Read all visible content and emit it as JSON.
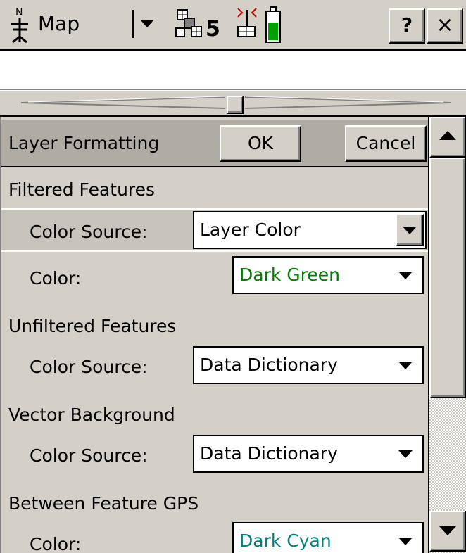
{
  "topbar": {
    "section_label": "Map",
    "north_icon": "north-arrow-icon",
    "satellite_icon": "satellite-icon",
    "satellite_count": "5",
    "beacon_icon": "beacon-icon",
    "battery_icon": "battery-icon",
    "battery_level": 0.6,
    "help_label": "?",
    "close_label": "×"
  },
  "form": {
    "title": "Layer Formatting",
    "ok_label": "OK",
    "cancel_label": "Cancel"
  },
  "sections": {
    "filtered": {
      "title": "Filtered Features",
      "color_source_label": "Color Source:",
      "color_source_value": "Layer Color",
      "color_label": "Color:",
      "color_value": "Dark Green"
    },
    "unfiltered": {
      "title": "Unfiltered Features",
      "color_source_label": "Color Source:",
      "color_source_value": "Data Dictionary"
    },
    "vector_background": {
      "title": "Vector Background",
      "color_source_label": "Color Source:",
      "color_source_value": "Data Dictionary"
    },
    "between_gps": {
      "title": "Between Feature GPS",
      "color_label": "Color:",
      "color_value": "Dark Cyan"
    }
  },
  "colors": {
    "dark_green": "#008000",
    "dark_cyan": "#008080",
    "battery_fill": "#00a000",
    "beacon_red": "#d00000"
  }
}
